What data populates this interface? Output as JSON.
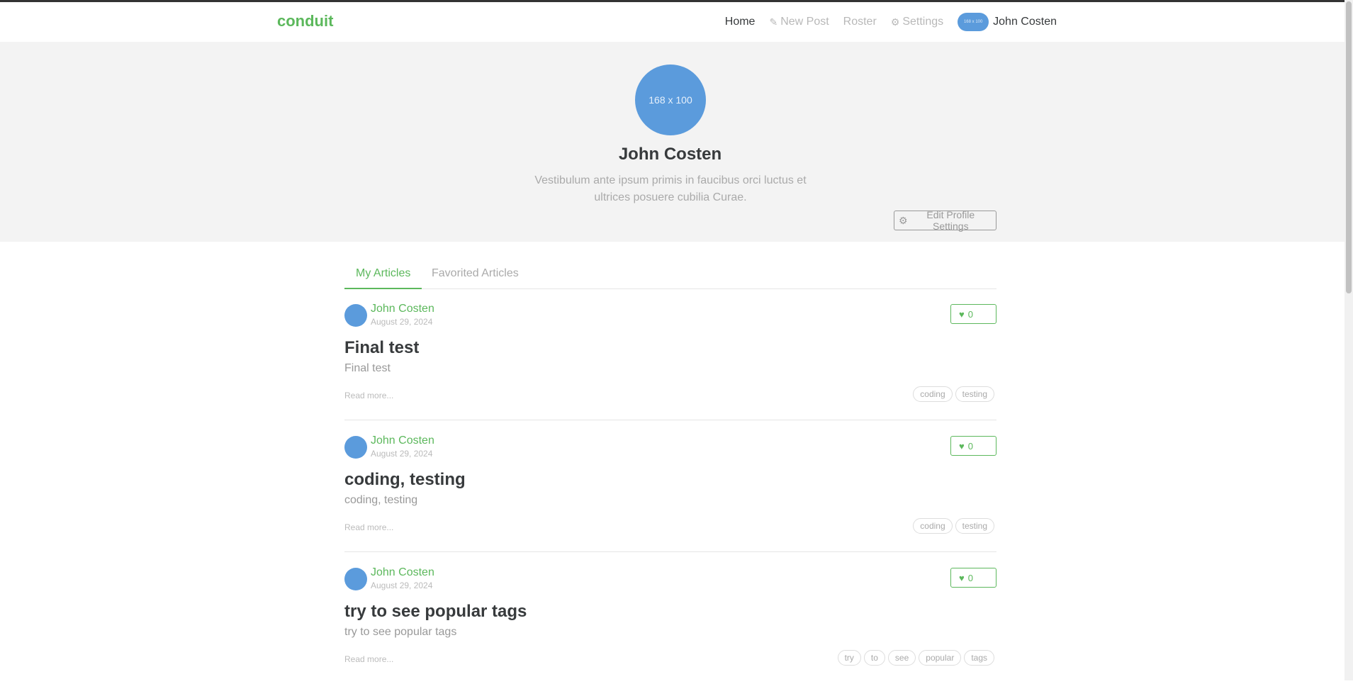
{
  "nav": {
    "brand": "conduit",
    "home": "Home",
    "new_post": "New Post",
    "roster": "Roster",
    "settings": "Settings",
    "user": "John Costen",
    "avatar_text": "168 x 100"
  },
  "profile": {
    "image_text": "168 x 100",
    "name": "John Costen",
    "bio": "Vestibulum ante ipsum primis in faucibus orci luctus et ultrices posuere cubilia Curae.",
    "edit_button": "Edit Profile Settings"
  },
  "tabs": {
    "my_articles": "My Articles",
    "favorited": "Favorited Articles"
  },
  "articles": [
    {
      "author": "John Costen",
      "date": "August 29, 2024",
      "favorites": "0",
      "title": "Final test",
      "description": "Final test",
      "read_more": "Read more...",
      "tags": [
        "coding",
        "testing"
      ]
    },
    {
      "author": "John Costen",
      "date": "August 29, 2024",
      "favorites": "0",
      "title": "coding, testing",
      "description": "coding, testing",
      "read_more": "Read more...",
      "tags": [
        "coding",
        "testing"
      ]
    },
    {
      "author": "John Costen",
      "date": "August 29, 2024",
      "favorites": "0",
      "title": "try to see popular tags",
      "description": "try to see popular tags",
      "read_more": "Read more...",
      "tags": [
        "try",
        "to",
        "see",
        "popular",
        "tags"
      ]
    }
  ],
  "colors": {
    "brand_green": "#5cb85c",
    "avatar_blue": "#5b9bdc",
    "banner_bg": "#f3f3f3"
  },
  "icons": {
    "new_post": "edit-icon",
    "settings": "gear-icon",
    "favorite": "heart-icon"
  }
}
